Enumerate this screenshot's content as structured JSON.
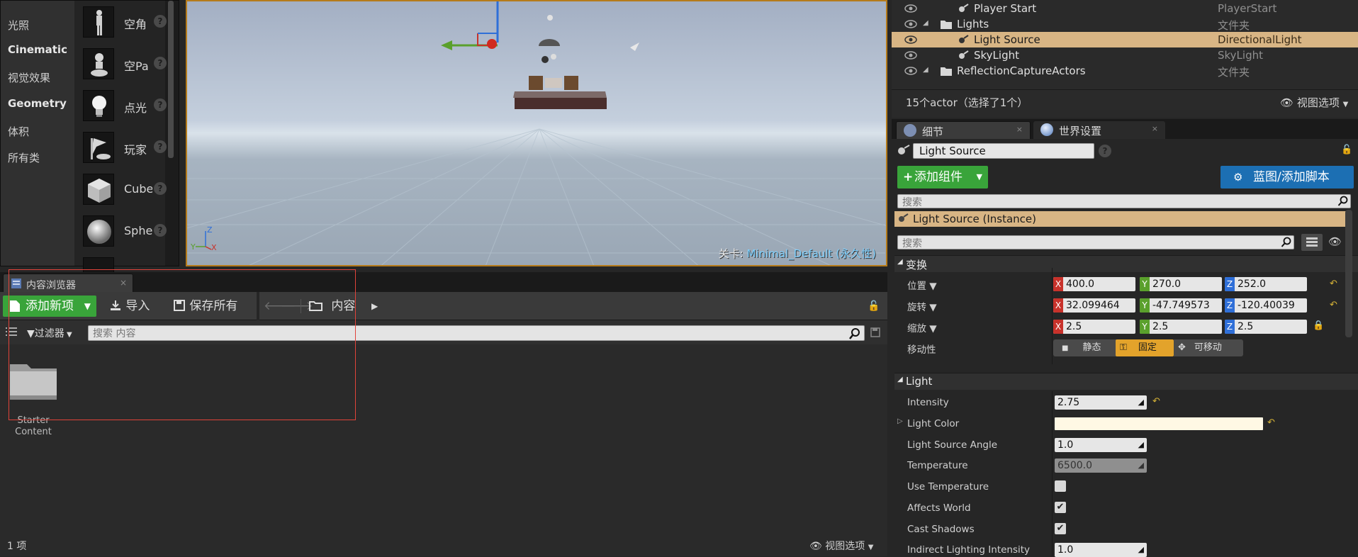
{
  "place_panel": {
    "categories": [
      "光照",
      "Cinematic",
      "视觉效果",
      "Geometry",
      "体积",
      "所有类"
    ],
    "items": [
      {
        "label": "空角",
        "icon": "empty-character-icon"
      },
      {
        "label": "空Pa",
        "icon": "empty-pawn-icon"
      },
      {
        "label": "点光",
        "icon": "point-light-icon"
      },
      {
        "label": "玩家",
        "icon": "player-start-icon"
      },
      {
        "label": "Cube",
        "icon": "cube-icon"
      },
      {
        "label": "Sphe",
        "icon": "sphere-icon"
      }
    ],
    "help_glyph": "?"
  },
  "viewport": {
    "level_prefix": "关卡:",
    "level_name": "Minimal_Default (永久性)"
  },
  "content_browser": {
    "tab_label": "内容浏览器",
    "tab_close": "×",
    "add_new": "添加新项",
    "import": "导入",
    "save_all": "保存所有",
    "path_root": "内容",
    "filters": "过滤器",
    "search_placeholder": "搜索 内容",
    "folder_label": "Starter Content",
    "item_count": "1 项",
    "view_options": "视图选项"
  },
  "outliner": {
    "rows": [
      {
        "name": "Player Start",
        "type": "PlayerStart",
        "indent": 3,
        "selected": false
      },
      {
        "name": "Lights",
        "type": "文件夹",
        "indent": 2,
        "selected": false
      },
      {
        "name": "Light Source",
        "type": "DirectionalLight",
        "indent": 3,
        "selected": true
      },
      {
        "name": "SkyLight",
        "type": "SkyLight",
        "indent": 3,
        "selected": false
      },
      {
        "name": "ReflectionCaptureActors",
        "type": "文件夹",
        "indent": 2,
        "selected": false
      }
    ],
    "count_text": "15个actor（选择了1个）",
    "view_options": "视图选项"
  },
  "details": {
    "tabs": [
      {
        "label": "细节",
        "close": "×"
      },
      {
        "label": "世界设置",
        "close": "×"
      }
    ],
    "actor_name": "Light Source",
    "add_component": "添加组件",
    "blueprint_button": "蓝图/添加脚本",
    "search_placeholder": "搜索",
    "component_instance": "Light Source (Instance)",
    "transform": {
      "section": "变换",
      "location_label": "位置",
      "rotation_label": "旋转",
      "scale_label": "缩放",
      "mobility_label": "移动性",
      "location": {
        "x": "400.0",
        "y": "270.0",
        "z": "252.0"
      },
      "rotation": {
        "x": "32.099464",
        "y": "-47.749573",
        "z": "-120.40039"
      },
      "scale": {
        "x": "2.5",
        "y": "2.5",
        "z": "2.5"
      },
      "mobility_options": [
        "静态",
        "固定",
        "可移动"
      ],
      "mobility_selected": "固定"
    },
    "light": {
      "section": "Light",
      "intensity_label": "Intensity",
      "intensity": "2.75",
      "color_label": "Light Color",
      "color_value": "#fff8e4",
      "angle_label": "Light Source Angle",
      "angle": "1.0",
      "temperature_label": "Temperature",
      "temperature": "6500.0",
      "use_temp_label": "Use Temperature",
      "use_temp": false,
      "affects_world_label": "Affects World",
      "affects_world": true,
      "cast_shadows_label": "Cast Shadows",
      "cast_shadows": true,
      "indirect_label": "Indirect Lighting Intensity",
      "indirect": "1.0"
    }
  },
  "colors": {
    "accent_orange": "#b57b1a",
    "selection": "#d8b584",
    "green_button": "#39a43a",
    "blue_button": "#1c6fb3",
    "axis_x": "#c8322b",
    "axis_y": "#5aa02c",
    "axis_z": "#2f6fd8"
  }
}
